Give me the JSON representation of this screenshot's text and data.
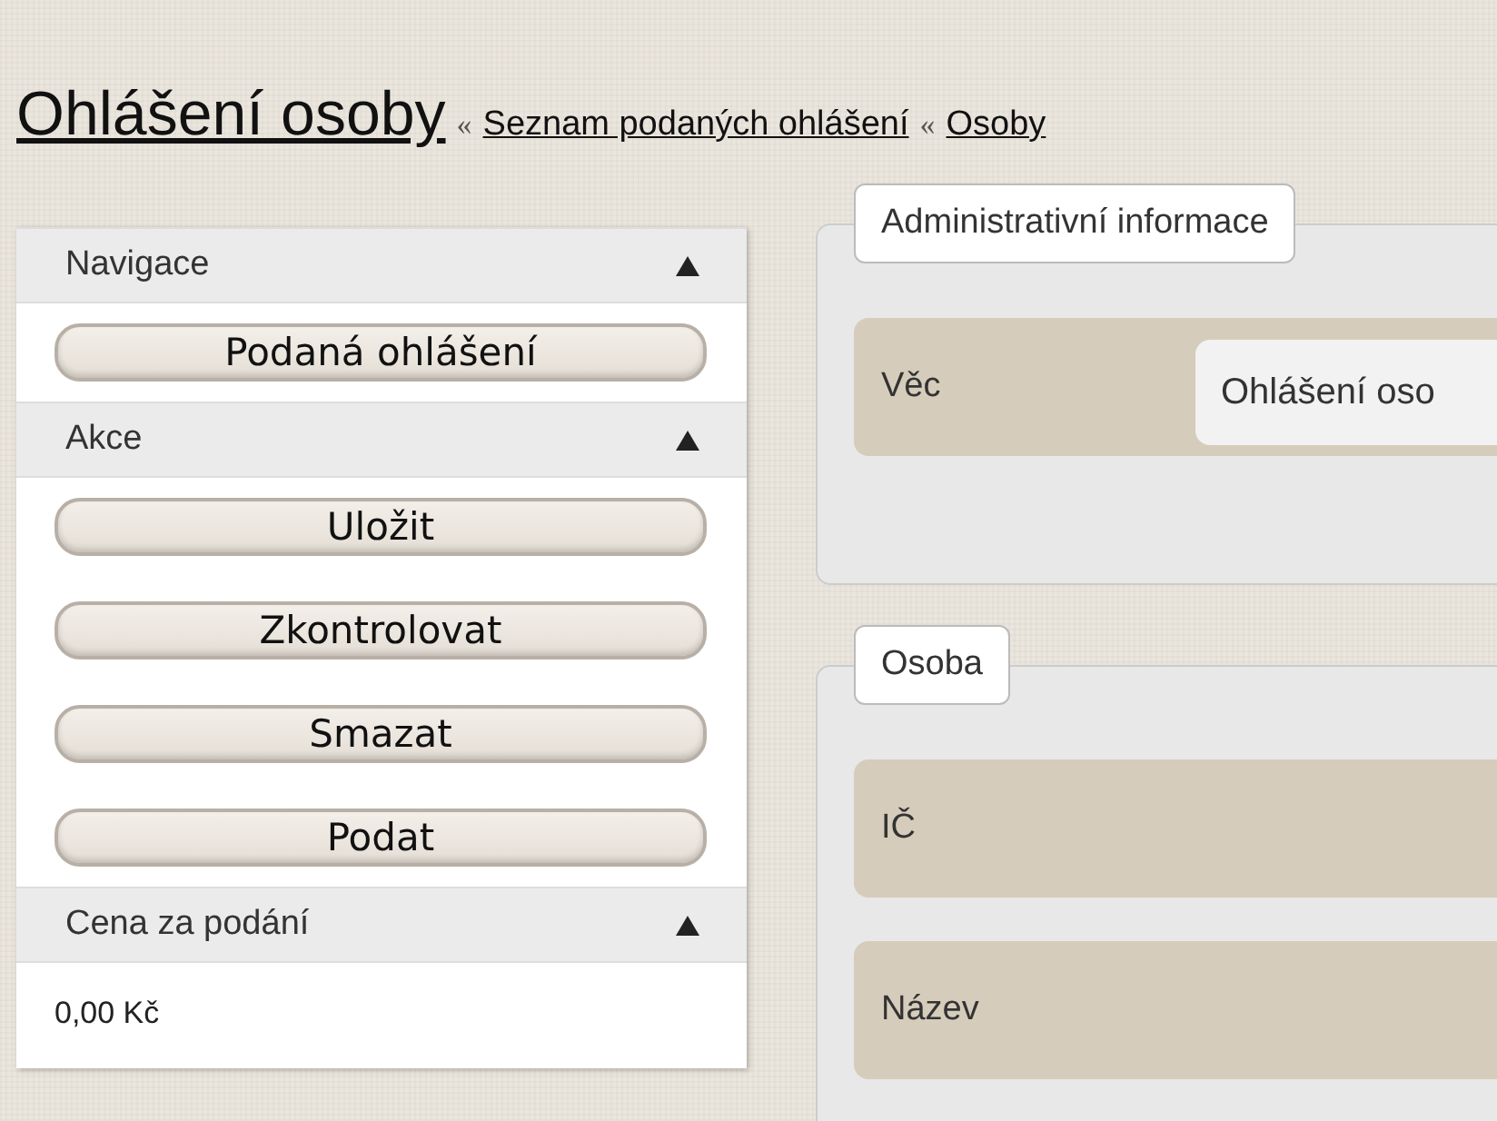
{
  "breadcrumb": {
    "title": "Ohlášení osoby",
    "separator": "«",
    "links": [
      "Seznam podaných ohlášení",
      "Osoby"
    ]
  },
  "sidebar": [
    {
      "kind": "buttons",
      "title": "Navigace",
      "expanded": true,
      "buttons": [
        "Podaná ohlášení"
      ]
    },
    {
      "kind": "buttons",
      "title": "Akce",
      "expanded": true,
      "buttons": [
        "Uložit",
        "Zkontrolovat",
        "Smazat",
        "Podat"
      ]
    },
    {
      "kind": "text",
      "title": "Cena za podání",
      "expanded": true,
      "text": "0,00 Kč"
    }
  ],
  "panels": [
    {
      "legend": "Administrativní informace",
      "rows": [
        {
          "label": "Věc",
          "value": "Ohlášení oso"
        }
      ]
    },
    {
      "legend": "Osoba",
      "rows": [
        {
          "label": "IČ"
        },
        {
          "label": "Název"
        }
      ]
    }
  ]
}
